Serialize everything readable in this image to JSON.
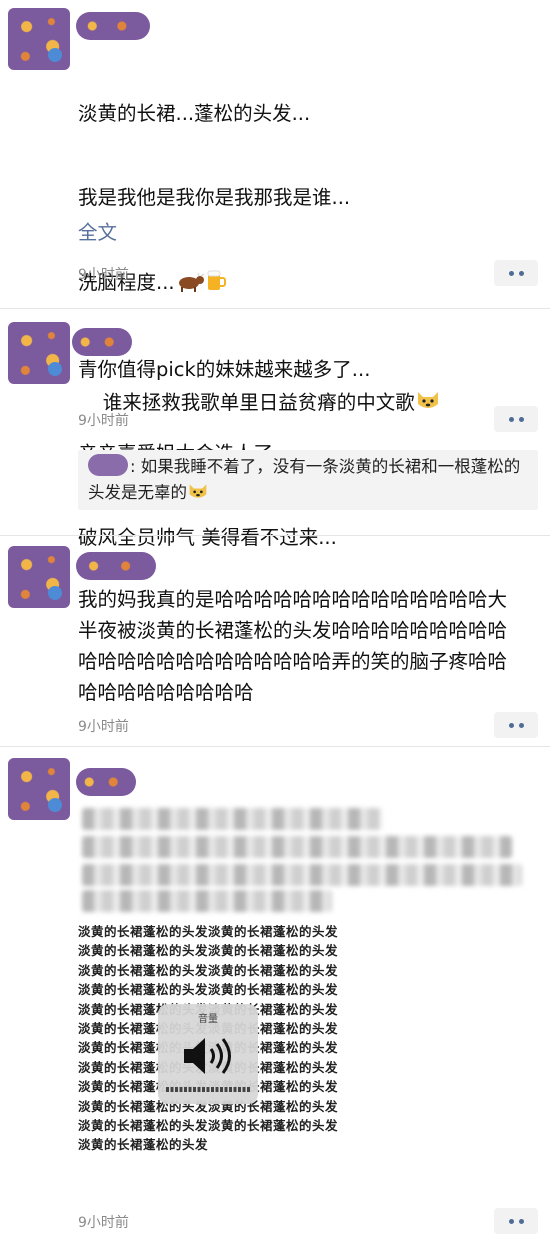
{
  "posts": [
    {
      "lines": [
        "淡黄的长裙...蓬松的头发...",
        "我是我他是我你是我那我是谁...",
        "洗脑程度...",
        "青你值得pick的妹妹越来越多了...",
        "亲亲喜爱姐太会选人了...",
        "破风全员帅气 美得看不过来..."
      ],
      "full_text_link": "全文",
      "time": "9小时前",
      "emoji_icons": [
        "cow-icon",
        "beer-icon"
      ]
    },
    {
      "text": "谁来拯救我歌单里日益贫瘠的中文歌",
      "time": "9小时前",
      "emoji_icon": "doge-icon",
      "reply": {
        "text": ": 如果我睡不着了，没有一条淡黄的长裙和一根蓬松的头发是无辜的",
        "emoji_icon": "doge-icon"
      }
    },
    {
      "text": "我的妈我真的是哈哈哈哈哈哈哈哈哈哈哈哈哈哈大半夜被淡黄的长裙蓬松的头发哈哈哈哈哈哈哈哈哈哈哈哈哈哈哈哈哈哈哈哈哈哈弄的笑的脑子疼哈哈哈哈哈哈哈哈哈哈哈",
      "time": "9小时前"
    },
    {
      "image_text": "淡黄的长裙蓬松的头发淡黄的长裙蓬松的头发淡黄的长裙蓬松的头发淡黄的长裙蓬松的头发淡黄的长裙蓬松的头发淡黄的长裙蓬松的头发淡黄的长裙蓬松的头发淡黄的长裙蓬松的头发淡黄的长裙蓬松的头发淡黄的长裙蓬松的头发淡黄的长裙蓬松的头发淡黄的长裙蓬松的头发淡黄的长裙蓬松的头发淡黄的长裙蓬松的头发淡黄的长裙蓬松的头发淡黄的长裙蓬松的头发淡黄的长裙蓬松的头发淡黄的长裙蓬松的头发淡黄的长裙蓬松的头发淡黄的长裙蓬松的头发淡黄的长裙蓬松的头发淡黄的长裙蓬松的头发淡黄的长裙蓬松的头发",
      "volume_label": "音量",
      "time": "9小时前"
    }
  ],
  "colors": {
    "link": "#57709b",
    "timestamp": "#8a8a8a",
    "reply_bg": "#f3f3f3",
    "more_dots": "#4f6c96"
  }
}
